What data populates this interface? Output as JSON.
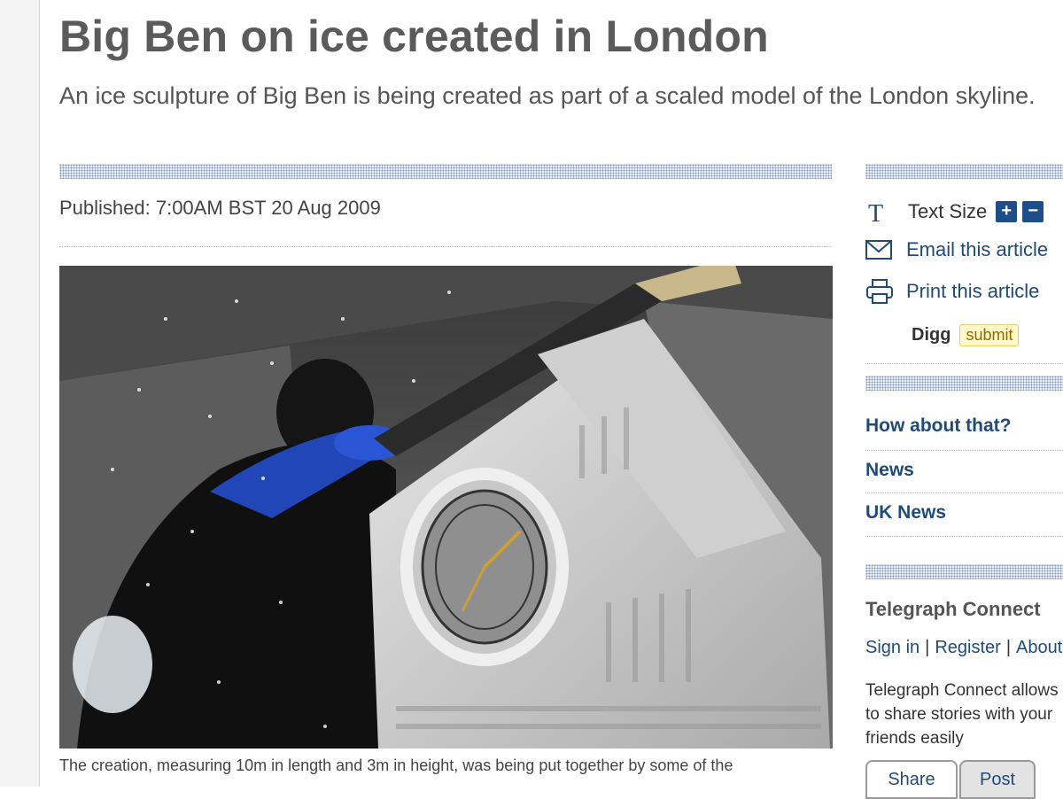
{
  "article": {
    "headline": "Big Ben on ice created in London",
    "standfirst": "An ice sculpture of Big Ben is being created as part of a scaled model of the London skyline.",
    "published": "Published: 7:00AM BST 20 Aug 2009",
    "caption": "The creation, measuring 10m in length and 3m in height, was being put together by some of the"
  },
  "tools": {
    "text_size_label": "Text Size",
    "increase_label": "+",
    "decrease_label": "−",
    "email_label": "Email this article",
    "print_label": "Print this article",
    "digg_label": "Digg",
    "digg_submit": "submit"
  },
  "sections": [
    "How about that?",
    "News",
    "UK News"
  ],
  "connect": {
    "title": "Telegraph Connect",
    "sign_in": "Sign in",
    "register": "Register",
    "about": "About",
    "description": "Telegraph Connect allows you to share stories with your friends easily",
    "share_label": "Share",
    "post_label": "Post"
  },
  "colors": {
    "link": "#1f4a7a",
    "headline": "#5b5b5b",
    "button_blue": "#1d4e8a",
    "digg_bg": "#fff8c8"
  },
  "icons": {
    "text_size": "serif-T-icon",
    "email": "envelope-icon",
    "print": "printer-icon"
  }
}
